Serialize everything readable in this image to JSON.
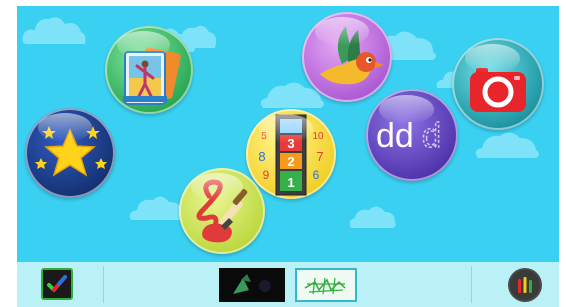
{
  "app": {
    "background_color": "#39d0f2",
    "dock_color": "#b9f1f6"
  },
  "launcher": {
    "apps": [
      {
        "icon": "star-icon",
        "bubble_color": "#1a3a8c"
      },
      {
        "icon": "photo-frame-icon",
        "bubble_color": "#2eb85c"
      },
      {
        "icon": "paint-brush-icon",
        "bubble_color": "#c8e34a"
      },
      {
        "icon": "number-ladder-icon",
        "bubble_color": "#f2d935"
      },
      {
        "icon": "bird-icon",
        "bubble_color": "#b05bd6"
      },
      {
        "icon": "letters-icon",
        "bubble_color": "#5a3fb8",
        "letters": "dd",
        "traced_letter": "d"
      },
      {
        "icon": "camera-icon",
        "bubble_color": "#1e9aa8"
      }
    ],
    "ladder_numbers": {
      "center": [
        "3",
        "2",
        "1"
      ],
      "left": [
        "5",
        "8",
        "9"
      ],
      "right": [
        "10",
        "7",
        "6"
      ]
    }
  },
  "dock": {
    "items": [
      {
        "icon": "checkmark-icon"
      },
      {
        "icon": "dark-photo-thumbnail-icon"
      },
      {
        "icon": "scribble-thumbnail-icon"
      },
      {
        "icon": "settings-bars-icon"
      }
    ]
  }
}
